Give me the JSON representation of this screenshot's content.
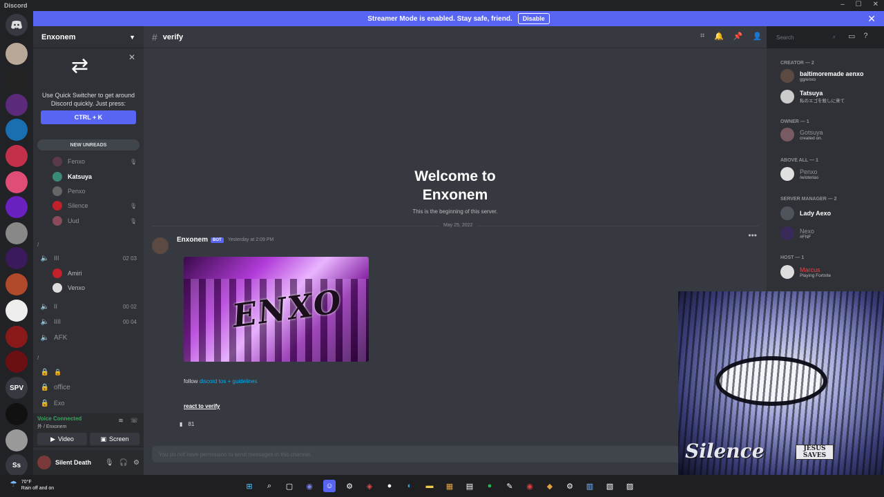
{
  "window": {
    "app_title": "Discord",
    "controls": [
      "–",
      "☐",
      "✕"
    ]
  },
  "banner": {
    "text": "Streamer Mode is enabled. Stay safe, friend.",
    "button": "Disable"
  },
  "server": {
    "name": "Enxonem"
  },
  "quick_switcher": {
    "text": "Use Quick Switcher to get around Discord quickly. Just press:",
    "shortcut": "CTRL + K"
  },
  "new_unreads": "NEW UNREADS",
  "channel_list": {
    "members": [
      {
        "name": "Fenxo",
        "bold": false
      },
      {
        "name": "Katsuya",
        "bold": true
      },
      {
        "name": "Penxo",
        "bold": false
      },
      {
        "name": "Silence",
        "bold": false
      },
      {
        "name": "Uud",
        "bold": false
      }
    ],
    "category1": "/",
    "voice1": {
      "name": "III",
      "count": "02",
      "limit": "03"
    },
    "voice1_users": [
      "Amiri",
      "Venxo"
    ],
    "voice2": {
      "name": "II",
      "count": "00",
      "limit": "02"
    },
    "voice3": {
      "name": "IIII",
      "count": "00",
      "limit": "04"
    },
    "afk": "AFK",
    "category2": "/",
    "locked": [
      "🔒",
      "office",
      "Exo"
    ]
  },
  "voice_panel": {
    "status": "Voice Connected",
    "sub": "外 / Enxonem",
    "video": "Video",
    "screen": "Screen"
  },
  "user": {
    "name": "Silent Death"
  },
  "channel": {
    "name": "verify"
  },
  "welcome": {
    "line1": "Welcome to",
    "line2": "Enxonem",
    "sub": "This is the beginning of this server."
  },
  "date_divider": "May 25, 2022",
  "message": {
    "author": "Enxonem",
    "bot_tag": "BOT",
    "timestamp": "Yesterday at 2:09 PM",
    "embed_logo": "ENXO",
    "text_prefix": "follow",
    "text_link": "discord tos + guidelines",
    "link2": "react to verify",
    "reaction_count": "81"
  },
  "input_placeholder": "You do not have permission to send messages in this channel.",
  "search": {
    "placeholder": "Search"
  },
  "member_list": {
    "roles": [
      {
        "title": "CREATOR — 2"
      },
      {
        "title": "OWNER — 1"
      },
      {
        "title": "ABOVE ALL — 1"
      },
      {
        "title": "SERVER MANAGER — 2"
      },
      {
        "title": "HOST — 1"
      }
    ],
    "members": [
      {
        "name": "baltimoremade aenxo",
        "status": "gg/enxo"
      },
      {
        "name": "Tatsuya",
        "status": "私のエゴを殺しに来て"
      },
      {
        "name": "Gotsuya",
        "status": "created on."
      },
      {
        "name": "Penxo",
        "status": "/wisterias"
      },
      {
        "name": "Lady Aexo",
        "status": ""
      },
      {
        "name": "Nexo",
        "status": "#FNF"
      },
      {
        "name": "Marcus",
        "status": "Playing Fortnite"
      }
    ]
  },
  "overlay": {
    "caption": "Silence",
    "sign": "JESUS SAVES"
  },
  "guild_icons": [
    "SPV",
    "Ss"
  ],
  "weather": {
    "temp": "70°F",
    "desc": "Rain off and on"
  }
}
